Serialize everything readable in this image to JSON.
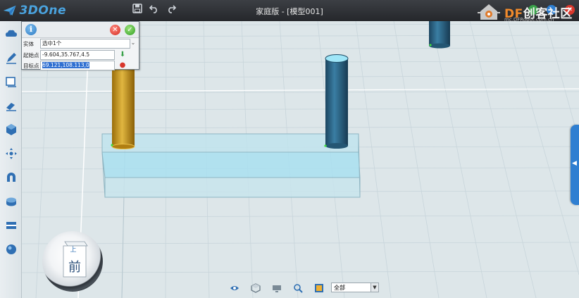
{
  "app": {
    "logo_text": "3DOne",
    "window_title": "家庭版 - [模型001]"
  },
  "brand": {
    "main_prefix": "DF",
    "main_text": "创客社区",
    "sub_text": "mc.DFRobot.com.cn"
  },
  "toolbar": {
    "icons": [
      "save-icon",
      "undo-icon",
      "redo-icon"
    ]
  },
  "left_toolbar": {
    "tools": [
      "sketch-cloud-icon",
      "pencil-icon",
      "face-icon",
      "eraser-icon",
      "cube-icon",
      "transform-icon",
      "magnet-icon",
      "combine-icon",
      "plane-icon",
      "sphere-icon"
    ]
  },
  "move_panel": {
    "entity_label": "实体",
    "entity_value": "选中1个",
    "start_label": "起始点",
    "start_value": "-9.604,35.767,4.5",
    "target_label": "目标点",
    "target_value": "69.121,108.113,0"
  },
  "view_cube": {
    "top_label": "上",
    "front_label": "前"
  },
  "bottom_bar": {
    "filter_value": "全部",
    "icons": [
      "eye-icon",
      "view-icon",
      "display-icon",
      "zoom-icon",
      "render-icon"
    ]
  },
  "colors": {
    "titlebar": "#2f3237",
    "grid_background": "#dfe7ea",
    "accent_blue": "#2f7fd1",
    "gold_cylinder": "#c9961c",
    "blue_cylinder": "#2b5d7a",
    "base_block": "#a9dff0"
  }
}
